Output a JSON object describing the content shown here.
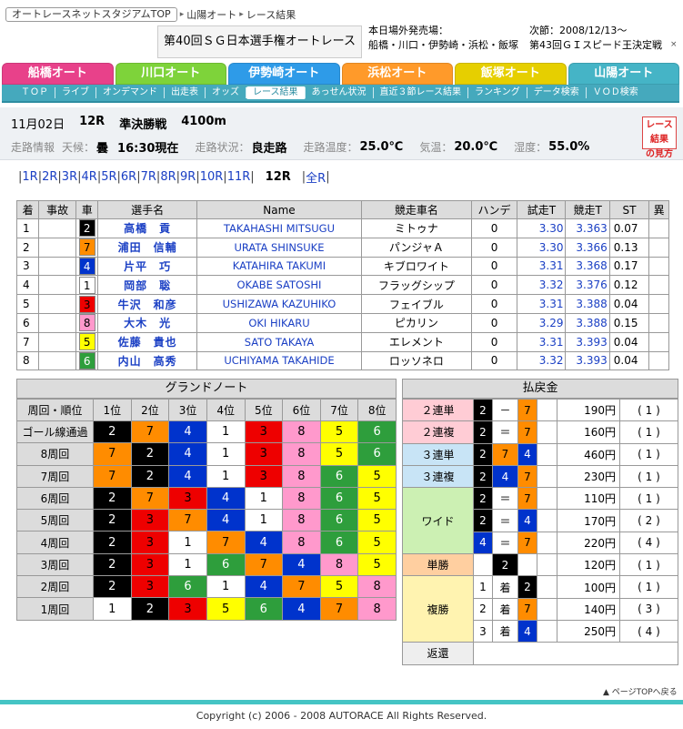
{
  "breadcrumb": {
    "home": "オートレースネットスタジアムTOP",
    "track": "山陽オート",
    "page": "レース結果"
  },
  "header": {
    "title": "第40回ＳＧ日本選手権オートレース",
    "sale_label": "本日場外発売場：",
    "sale_venues": "船橋・川口・伊勢崎・浜松・飯塚",
    "next_label": "次節：2008/12/13～",
    "next_event": "第43回ＧＩスピード王決定戦",
    "close_mark": "×"
  },
  "tabs": [
    {
      "label": "船橋オート",
      "color": "#e8418a"
    },
    {
      "label": "川口オート",
      "color": "#7ed33a"
    },
    {
      "label": "伊勢崎オート",
      "color": "#2e9be8"
    },
    {
      "label": "浜松オート",
      "color": "#ff9a2a"
    },
    {
      "label": "飯塚オート",
      "color": "#e6cf00"
    },
    {
      "label": "山陽オート",
      "color": "#45b4c6"
    }
  ],
  "subnav": [
    "ＴＯＰ",
    "ライブ",
    "オンデマンド",
    "出走表",
    "オッズ",
    "レース結果",
    "あっせん状況",
    "直近３節レース結果",
    "ランキング",
    "データ検索",
    "ＶＯＤ検索"
  ],
  "subnav_active": "レース結果",
  "race": {
    "date": "11月02日",
    "number": "12R",
    "type": "準決勝戦",
    "distance": "4100m",
    "info_label": "走路情報",
    "weather_label": "天候：",
    "weather": "曇",
    "time": "16:30現在",
    "track_label": "走路状況：",
    "track": "良走路",
    "track_temp_label": "走路温度：",
    "track_temp": "25.0℃",
    "air_label": "気温：",
    "air": "20.0℃",
    "humidity_label": "湿度：",
    "humidity": "55.0%"
  },
  "rule_button": {
    "line1": "レース結果",
    "line2": "の見方"
  },
  "race_nav": [
    "1R",
    "2R",
    "3R",
    "4R",
    "5R",
    "6R",
    "7R",
    "8R",
    "9R",
    "10R",
    "11R",
    "12R",
    "全R"
  ],
  "race_nav_current": "12R",
  "results": {
    "headers": [
      "着",
      "事故",
      "車",
      "選手名",
      "Name",
      "競走車名",
      "ハンデ",
      "試走T",
      "競走T",
      "ST",
      "異"
    ],
    "rows": [
      {
        "pos": "1",
        "car": "2",
        "name": "高橋　貢",
        "ename": "TAKAHASHI MITSUGU",
        "bike": "ミトゥナ",
        "handi": "0",
        "trial": "3.30",
        "race_t": "3.363",
        "st": "0.07"
      },
      {
        "pos": "2",
        "car": "7",
        "name": "浦田　信輔",
        "ename": "URATA SHINSUKE",
        "bike": "パンジャＡ",
        "handi": "0",
        "trial": "3.30",
        "race_t": "3.366",
        "st": "0.13"
      },
      {
        "pos": "3",
        "car": "4",
        "name": "片平　巧",
        "ename": "KATAHIRA TAKUMI",
        "bike": "キブロワイト",
        "handi": "0",
        "trial": "3.31",
        "race_t": "3.368",
        "st": "0.17"
      },
      {
        "pos": "4",
        "car": "1",
        "name": "岡部　聡",
        "ename": "OKABE SATOSHI",
        "bike": "フラッグシップ",
        "handi": "0",
        "trial": "3.32",
        "race_t": "3.376",
        "st": "0.12"
      },
      {
        "pos": "5",
        "car": "3",
        "name": "牛沢　和彦",
        "ename": "USHIZAWA KAZUHIKO",
        "bike": "フェイブル",
        "handi": "0",
        "trial": "3.31",
        "race_t": "3.388",
        "st": "0.04"
      },
      {
        "pos": "6",
        "car": "8",
        "name": "大木　光",
        "ename": "OKI HIKARU",
        "bike": "ピカリン",
        "handi": "0",
        "trial": "3.29",
        "race_t": "3.388",
        "st": "0.15"
      },
      {
        "pos": "7",
        "car": "5",
        "name": "佐藤　貴也",
        "ename": "SATO TAKAYA",
        "bike": "エレメント",
        "handi": "0",
        "trial": "3.31",
        "race_t": "3.393",
        "st": "0.04"
      },
      {
        "pos": "8",
        "car": "6",
        "name": "内山　高秀",
        "ename": "UCHIYAMA TAKAHIDE",
        "bike": "ロッソネロ",
        "handi": "0",
        "trial": "3.32",
        "race_t": "3.393",
        "st": "0.04"
      }
    ]
  },
  "grand_note": {
    "title": "グランドノート",
    "headers": [
      "周回・順位",
      "1位",
      "2位",
      "3位",
      "4位",
      "5位",
      "6位",
      "7位",
      "8位"
    ],
    "rows": [
      {
        "label": "ゴール線通過",
        "cars": [
          "2",
          "7",
          "4",
          "1",
          "3",
          "8",
          "5",
          "6"
        ]
      },
      {
        "label": "8周回",
        "cars": [
          "7",
          "2",
          "4",
          "1",
          "3",
          "8",
          "5",
          "6"
        ]
      },
      {
        "label": "7周回",
        "cars": [
          "7",
          "2",
          "4",
          "1",
          "3",
          "8",
          "6",
          "5"
        ]
      },
      {
        "label": "6周回",
        "cars": [
          "2",
          "7",
          "3",
          "4",
          "1",
          "8",
          "6",
          "5"
        ]
      },
      {
        "label": "5周回",
        "cars": [
          "2",
          "3",
          "7",
          "4",
          "1",
          "8",
          "6",
          "5"
        ]
      },
      {
        "label": "4周回",
        "cars": [
          "2",
          "3",
          "1",
          "7",
          "4",
          "8",
          "6",
          "5"
        ]
      },
      {
        "label": "3周回",
        "cars": [
          "2",
          "3",
          "1",
          "6",
          "7",
          "4",
          "8",
          "5"
        ]
      },
      {
        "label": "2周回",
        "cars": [
          "2",
          "3",
          "6",
          "1",
          "4",
          "7",
          "5",
          "8"
        ]
      },
      {
        "label": "1周回",
        "cars": [
          "1",
          "2",
          "3",
          "5",
          "6",
          "4",
          "7",
          "8"
        ]
      }
    ]
  },
  "payout": {
    "title": "払戻金",
    "exacta": {
      "label": "２連単",
      "cars": [
        "2",
        "7"
      ],
      "sym": "－",
      "amount": "190円",
      "pop": "( 1 )"
    },
    "quinella": {
      "label": "２連複",
      "cars": [
        "2",
        "7"
      ],
      "sym": "＝",
      "amount": "160円",
      "pop": "( 1 )"
    },
    "trifecta": {
      "label": "３連単",
      "cars": [
        "2",
        "7",
        "4"
      ],
      "sym": "－",
      "amount": "460円",
      "pop": "( 1 )"
    },
    "trio": {
      "label": "３連複",
      "cars": [
        "2",
        "4",
        "7"
      ],
      "sym": "＝",
      "amount": "230円",
      "pop": "( 1 )"
    },
    "wide": {
      "label": "ワイド",
      "sym": "＝",
      "rows": [
        {
          "cars": [
            "2",
            "7"
          ],
          "amount": "110円",
          "pop": "( 1 )"
        },
        {
          "cars": [
            "2",
            "4"
          ],
          "amount": "170円",
          "pop": "( 2 )"
        },
        {
          "cars": [
            "4",
            "7"
          ],
          "amount": "220円",
          "pop": "( 4 )"
        }
      ]
    },
    "win": {
      "label": "単勝",
      "car": "2",
      "amount": "120円",
      "pop": "( 1 )"
    },
    "place": {
      "label": "複勝",
      "unit": "着",
      "rows": [
        {
          "rank": "1",
          "car": "2",
          "amount": "100円",
          "pop": "( 1 )"
        },
        {
          "rank": "2",
          "car": "7",
          "amount": "140円",
          "pop": "( 3 )"
        },
        {
          "rank": "3",
          "car": "4",
          "amount": "250円",
          "pop": "( 4 )"
        }
      ]
    },
    "refund": {
      "label": "返還"
    }
  },
  "to_top": "ページTOPへ戻る",
  "footer": "Copyright (c) 2006 - 2008 AUTORACE All Rights Reserved."
}
